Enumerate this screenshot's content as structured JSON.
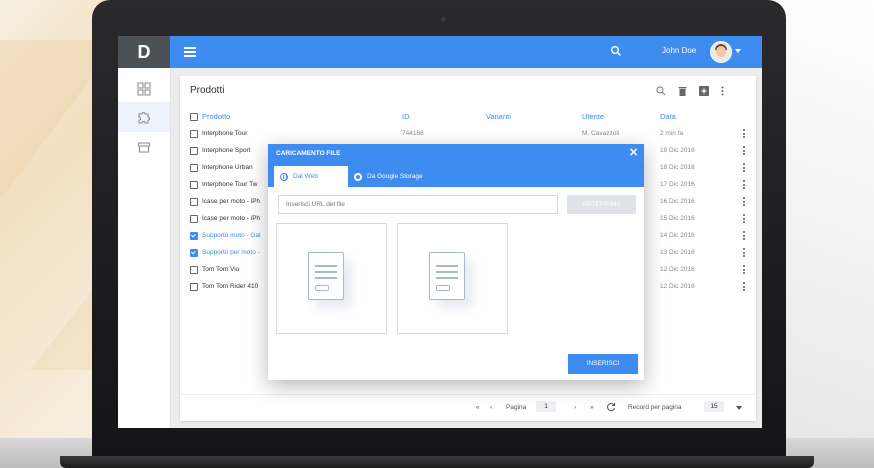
{
  "app": {
    "logo": "D",
    "user": "John Doe"
  },
  "products": {
    "title": "Prodotti",
    "columns": {
      "product": "Prodotto",
      "id": "ID",
      "variants": "Varianti",
      "user": "Utente",
      "date": "Data"
    },
    "rows": [
      {
        "name": "Interphone Tour",
        "id": "744166",
        "user": "M. Cavazzoli",
        "date": "2 min fa",
        "checked": false
      },
      {
        "name": "Interphone Sport",
        "date": "19 Dic 2016",
        "checked": false
      },
      {
        "name": "Interphone Urban",
        "date": "18 Dic 2016",
        "checked": false
      },
      {
        "name": "Interphone Tour Tw",
        "date": "17 Dic 2016",
        "checked": false
      },
      {
        "name": "Icase per moto - iPh",
        "date": "16 Dic 2016",
        "checked": false
      },
      {
        "name": "Icase per moto - iPh",
        "date": "15 Dic 2016",
        "checked": false
      },
      {
        "name": "Supporto moto - Gal",
        "date": "14 Dic 2016",
        "checked": true
      },
      {
        "name": "Supporto per moto -",
        "date": "13 Dic 2016",
        "checked": true
      },
      {
        "name": "Tom Tom Vio",
        "date": "12 Dic 2016",
        "checked": false
      },
      {
        "name": "Tom Tom Rider 410",
        "date": "12 Dic 2016",
        "checked": false
      }
    ],
    "pagination": {
      "page_label": "Pagina",
      "page": "1",
      "per_page_label": "Record per pagina",
      "per_page": "15"
    }
  },
  "dialog": {
    "title": "CARICAMENTO FILE",
    "tabs": [
      {
        "label": "Dal Web"
      },
      {
        "label": "Da Google Storage"
      }
    ],
    "url_placeholder": "Inserisci URL del file",
    "preview_button": "ANTEPRIMA",
    "insert_button": "INSERISCI"
  },
  "colors": {
    "primary": "#3e8cf0",
    "sidebar_logo": "#4b5157"
  }
}
